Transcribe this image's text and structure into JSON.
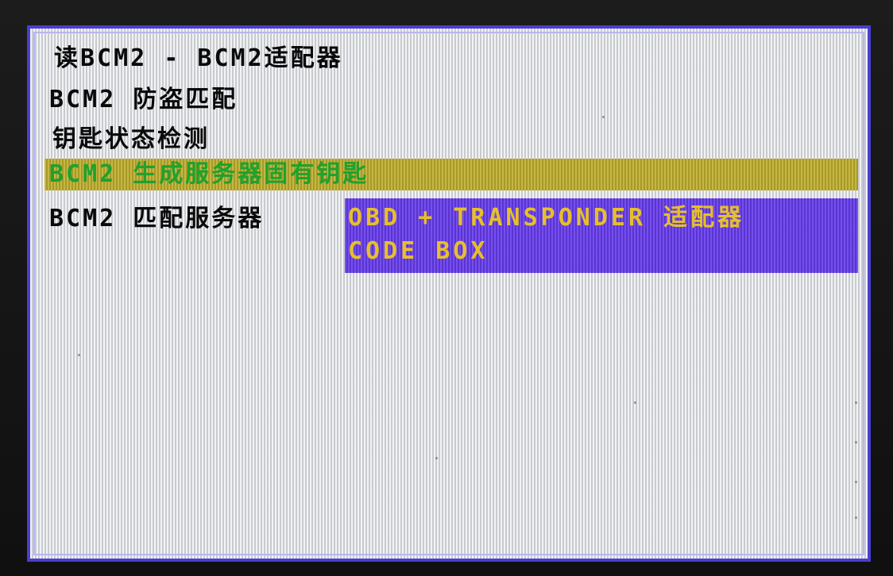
{
  "menu": {
    "items": [
      {
        "label": "读BCM2 - BCM2适配器"
      },
      {
        "label": "BCM2 防盗匹配"
      },
      {
        "label": "钥匙状态检测"
      },
      {
        "label": "BCM2 生成服务器固有钥匙",
        "selected": true
      },
      {
        "label": "BCM2 匹配服务器"
      }
    ]
  },
  "popup": {
    "lines": [
      "OBD + TRANSPONDER 适配器",
      "CODE BOX"
    ]
  },
  "colors": {
    "screen_border": "#4a3fd0",
    "highlight_bg": "#b8a72a",
    "highlight_text": "#1fa12f",
    "popup_bg": "#6a3fe6",
    "popup_text": "#e6c02a",
    "menu_text": "#0a0a0a"
  }
}
